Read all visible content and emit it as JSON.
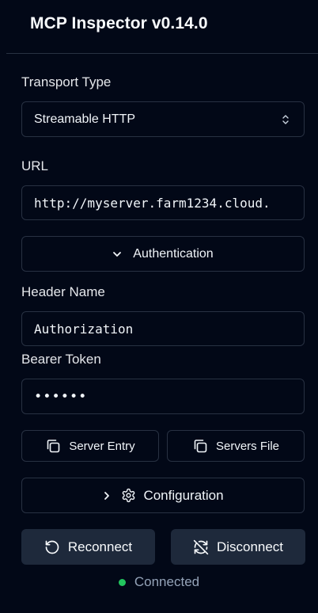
{
  "app": {
    "title": "MCP Inspector v0.14.0"
  },
  "transport": {
    "label": "Transport Type",
    "value": "Streamable HTTP"
  },
  "url": {
    "label": "URL",
    "value": "http://myserver.farm1234.cloud."
  },
  "auth": {
    "toggle_label": "Authentication"
  },
  "header_name": {
    "label": "Header Name",
    "value": "Authorization"
  },
  "bearer_token": {
    "label": "Bearer Token",
    "value": "••••••"
  },
  "copy_buttons": {
    "server_entry": "Server Entry",
    "servers_file": "Servers File"
  },
  "configuration": {
    "label": "Configuration"
  },
  "actions": {
    "reconnect": "Reconnect",
    "disconnect": "Disconnect"
  },
  "status": {
    "text": "Connected",
    "color": "#22c55e"
  },
  "icons": {
    "select": "chevron-up-down-icon",
    "auth": "chevron-down-icon",
    "config_chevron": "chevron-right-icon",
    "config": "gear-icon",
    "copy": "copy-icon",
    "reconnect": "rotate-ccw-icon",
    "disconnect": "refresh-off-icon"
  }
}
